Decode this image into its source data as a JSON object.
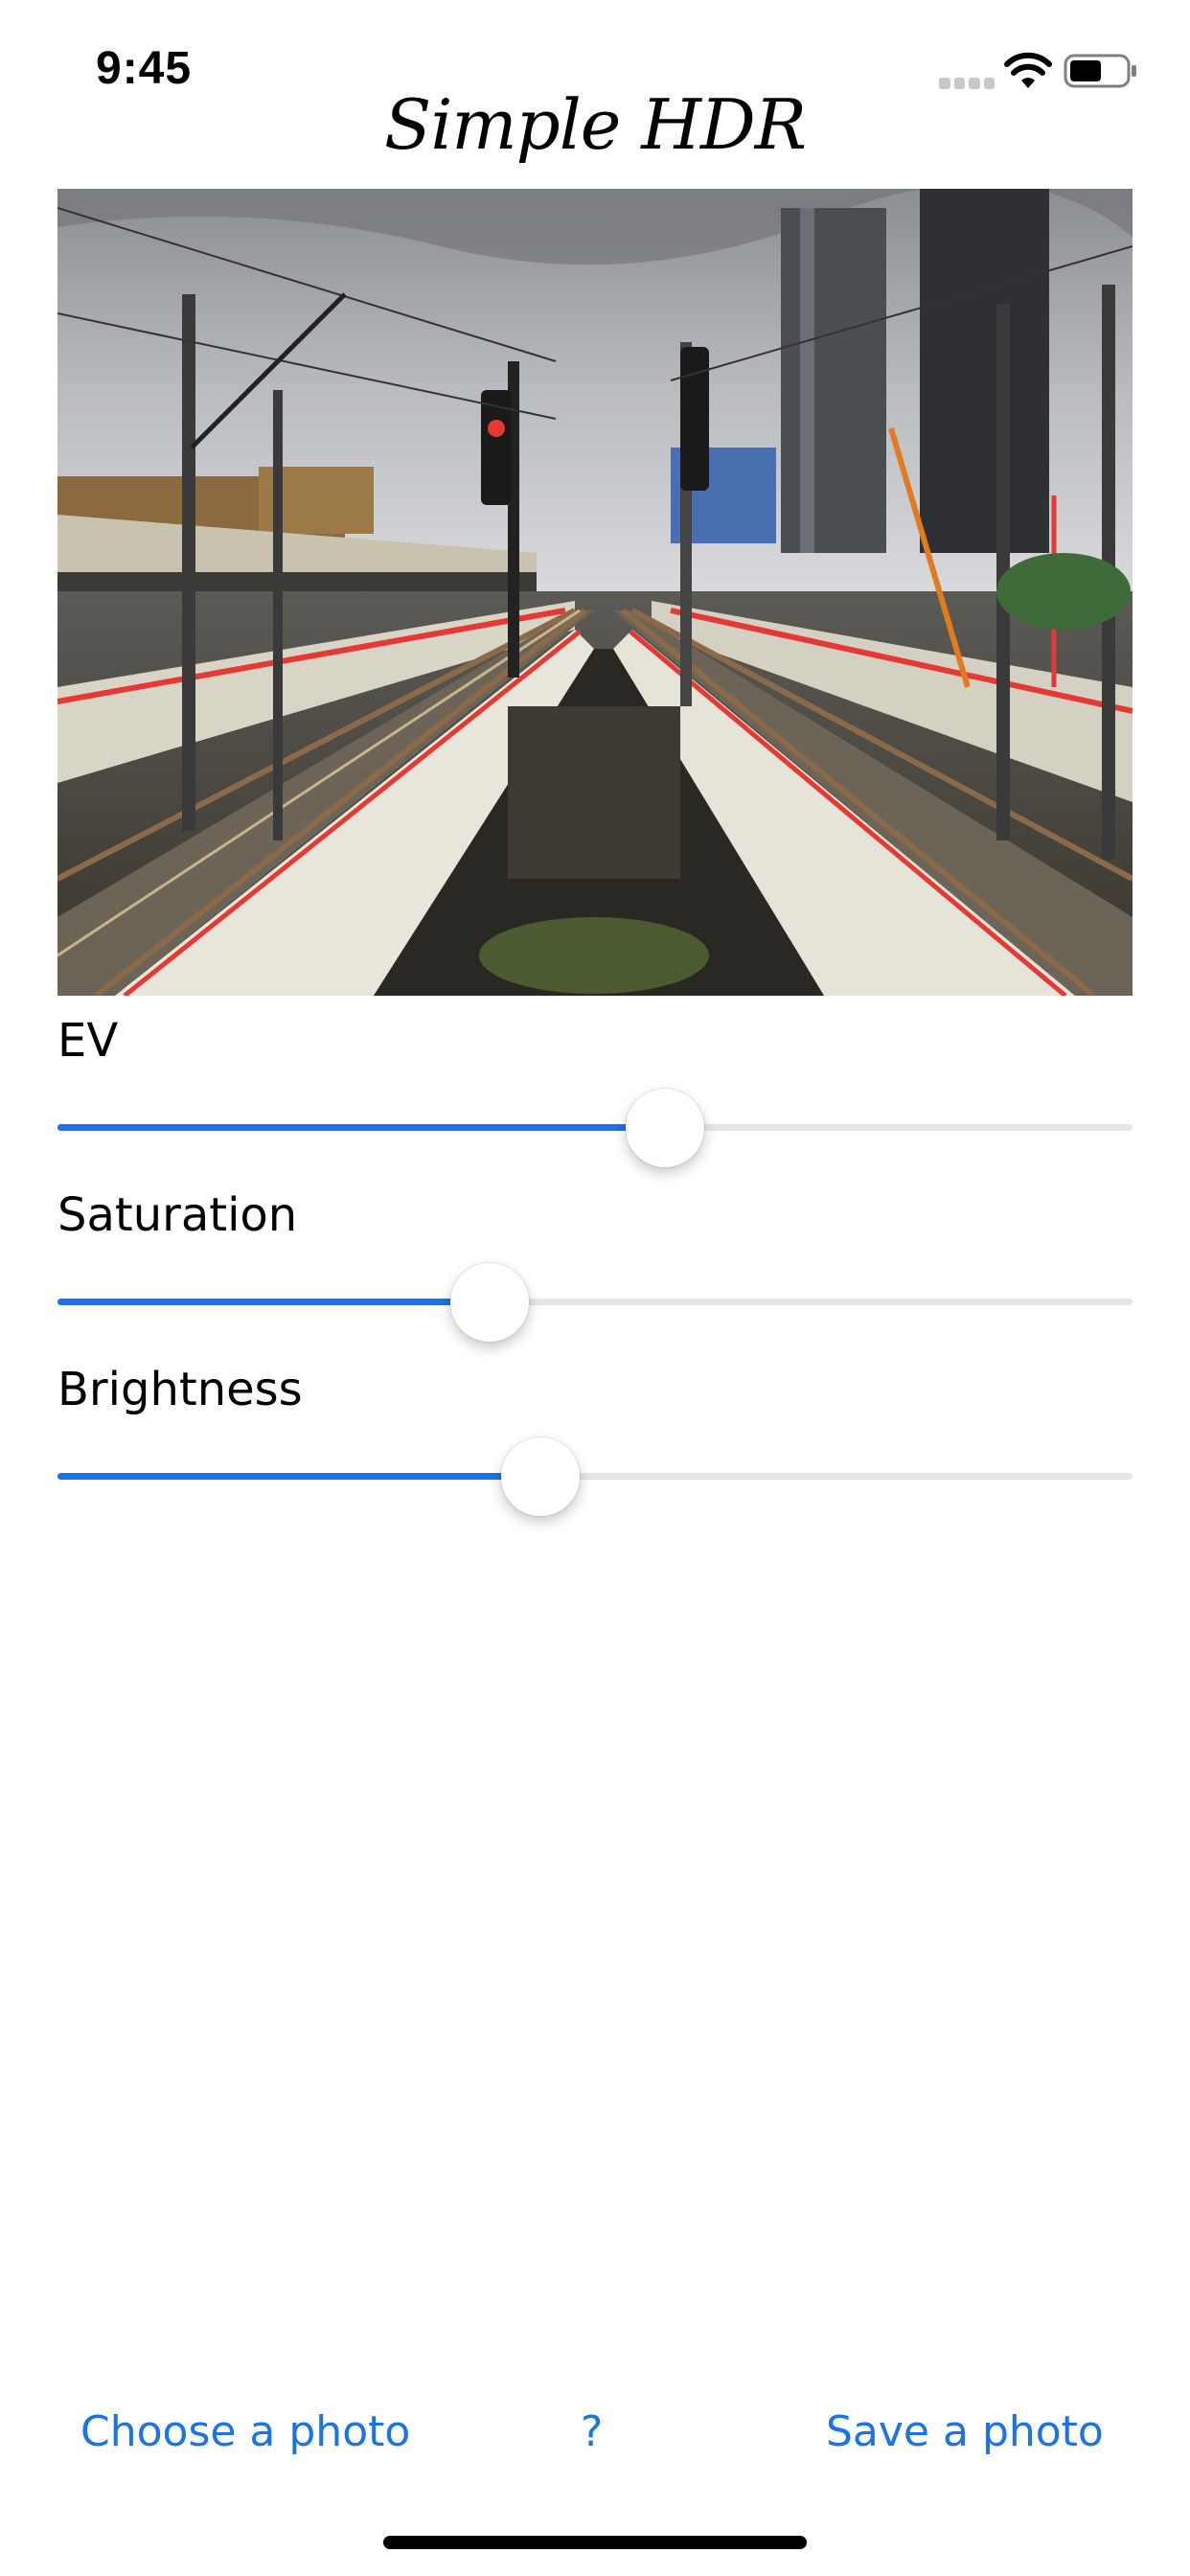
{
  "status_bar": {
    "time": "9:45",
    "icons": [
      "signal-icon",
      "wifi-icon",
      "battery-icon"
    ]
  },
  "app": {
    "title": "Simple HDR"
  },
  "photo": {
    "subject": "railway tracks photo"
  },
  "sliders": [
    {
      "label": "EV",
      "value": 0.565
    },
    {
      "label": "Saturation",
      "value": 0.402
    },
    {
      "label": "Brightness",
      "value": 0.449
    }
  ],
  "toolbar": {
    "choose_label": "Choose a photo",
    "help_label": "?",
    "save_label": "Save a photo"
  },
  "colors": {
    "accent": "#1a73e8",
    "track": "#e5e5ea",
    "background": "#ffffff"
  }
}
